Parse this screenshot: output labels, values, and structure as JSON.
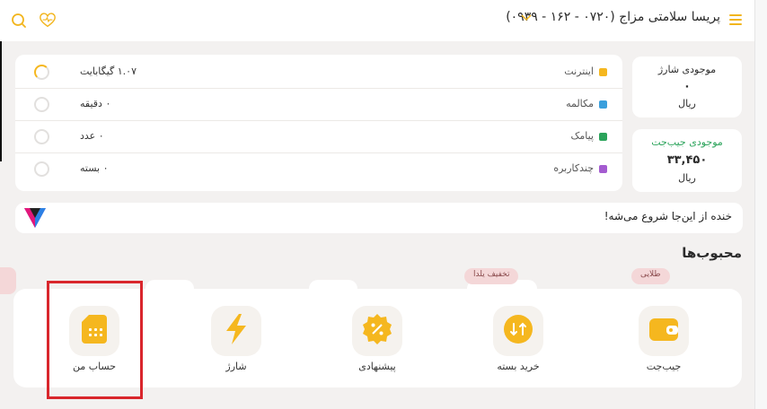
{
  "header": {
    "title": "پریسا سلامتی مزاج (۰۷۲۰ - ۱۶۲ - ۰۹۳۹)",
    "icons": [
      "menu-icon",
      "chevron-down-icon",
      "heart-pulse-icon",
      "search-icon"
    ]
  },
  "balances": {
    "charge": {
      "label": "موجودی شارژ",
      "value": "۰",
      "unit": "ریال"
    },
    "wallet": {
      "label": "موجودی جیب‌جت",
      "value": "۳۳,۴۵۰",
      "unit": "ریال"
    }
  },
  "usage": [
    {
      "label": "اینترنت",
      "value": "۱.۰۷ گیگابایت",
      "color": "#f5b71f"
    },
    {
      "label": "مکالمه",
      "value": "۰ دقیقه",
      "color": "#3a9fdc"
    },
    {
      "label": "پیامک",
      "value": "۰ عدد",
      "color": "#2aa35a"
    },
    {
      "label": "چندکاربره",
      "value": "۰ بسته",
      "color": "#a45bd0"
    }
  ],
  "banner": {
    "text": "خنده از این‌جا شروع می‌شه!"
  },
  "favorites": {
    "title": "محبوب‌ها",
    "tags": [
      "طلایی",
      "تخفیف یلدا"
    ],
    "items": [
      {
        "label": "جیب‌جت",
        "icon": "wallet-icon"
      },
      {
        "label": "خرید بسته",
        "icon": "buy-package-icon"
      },
      {
        "label": "پیشنهادی",
        "icon": "discount-badge-icon"
      },
      {
        "label": "شارژ",
        "icon": "lightning-icon"
      },
      {
        "label": "حساب من",
        "icon": "sim-card-icon"
      }
    ]
  },
  "colors": {
    "accent": "#f2b51d",
    "highlight": "#d9262c"
  }
}
